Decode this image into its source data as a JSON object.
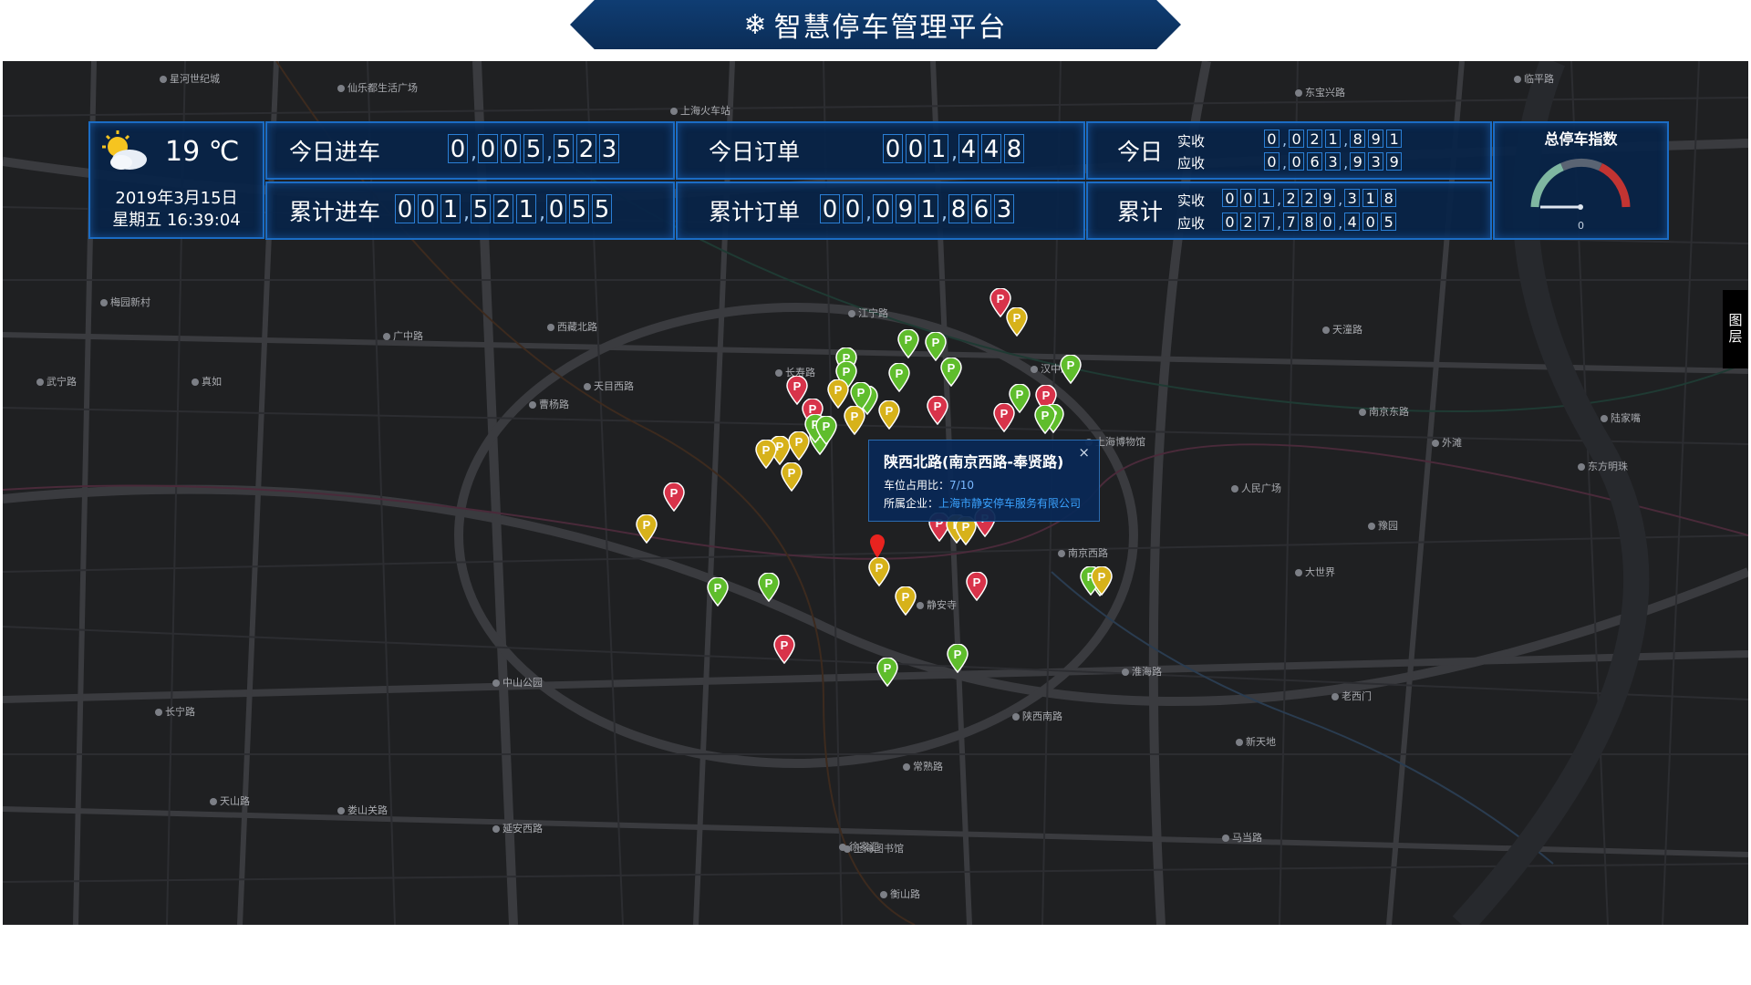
{
  "app_title": "智慧停车管理平台",
  "weather": {
    "temperature": "19 ℃",
    "date": "2019年3月15日",
    "weekday_time": "星期五  16:39:04",
    "icon": "partly-cloudy-icon"
  },
  "stats": {
    "today_in": {
      "label": "今日进车",
      "digits": [
        "0",
        ",",
        "0",
        "0",
        "5",
        ",",
        "5",
        "2",
        "3"
      ]
    },
    "total_in": {
      "label": "累计进车",
      "digits": [
        "0",
        "0",
        "1",
        ",",
        "5",
        "2",
        "1",
        ",",
        "0",
        "5",
        "5"
      ]
    },
    "today_orders": {
      "label": "今日订单",
      "digits": [
        "0",
        "0",
        "1",
        ",",
        "4",
        "4",
        "8"
      ]
    },
    "total_orders": {
      "label": "累计订单",
      "digits": [
        "0",
        "0",
        ",",
        "0",
        "9",
        "1",
        ",",
        "8",
        "6",
        "3"
      ]
    }
  },
  "money": {
    "today_label": "今日",
    "total_label": "累计",
    "paid_label": "实收",
    "due_label": "应收",
    "today_paid": [
      "0",
      ",",
      "0",
      "2",
      "1",
      ",",
      "8",
      "9",
      "1"
    ],
    "today_due": [
      "0",
      ",",
      "0",
      "6",
      "3",
      ",",
      "9",
      "3",
      "9"
    ],
    "total_paid": [
      "0",
      "0",
      "1",
      ",",
      "2",
      "2",
      "9",
      ",",
      "3",
      "1",
      "8"
    ],
    "total_due": [
      "0",
      "2",
      "7",
      ",",
      "7",
      "8",
      "0",
      ",",
      "4",
      "0",
      "5"
    ]
  },
  "gauge": {
    "title": "总停车指数",
    "value": "0",
    "value_fraction": 0
  },
  "popup": {
    "title": "陕西北路(南京西路-奉贤路)",
    "occupancy_label": "车位占用比：",
    "occupancy_value": "7/10",
    "company_label": "所属企业：",
    "company": "上海市静安停车服务有限公司",
    "close_icon": "close-icon"
  },
  "layer_tab": "图层",
  "colors": {
    "green": "#5fbd2c",
    "yellow": "#d7b21a",
    "red": "#d8334a",
    "panel_border": "#1b6cc4",
    "title_bg": "#0f3d73"
  },
  "map_labels": [
    "星河世纪城",
    "仙乐都生活广场",
    "上海火车站",
    "东宝兴路",
    "临平路",
    "梅园新村",
    "广中路",
    "西藏北路",
    "天目西路",
    "真如",
    "武宁路",
    "曹杨路",
    "长寿路",
    "江宁路",
    "南京西路",
    "人民广场",
    "南京东路",
    "陆家嘴",
    "东方明珠",
    "外滩",
    "豫园",
    "大世界",
    "新天地",
    "淮海路",
    "陕西南路",
    "常熟路",
    "徐家汇",
    "长宁路",
    "天山路",
    "中山公园",
    "娄山关路",
    "延安西路",
    "上海图书馆",
    "衡山路",
    "汉中路",
    "静安寺",
    "老西门",
    "马当路",
    "天潼路",
    "上海博物馆"
  ],
  "pins": [
    {
      "c": "red"
    },
    {
      "c": "yellow"
    },
    {
      "c": "green"
    },
    {
      "c": "green"
    },
    {
      "c": "green"
    },
    {
      "c": "green"
    },
    {
      "c": "green"
    },
    {
      "c": "green"
    },
    {
      "c": "green"
    },
    {
      "c": "yellow"
    },
    {
      "c": "green"
    },
    {
      "c": "red"
    },
    {
      "c": "red"
    },
    {
      "c": "yellow"
    },
    {
      "c": "yellow"
    },
    {
      "c": "red"
    },
    {
      "c": "red"
    },
    {
      "c": "green"
    },
    {
      "c": "green"
    },
    {
      "c": "red"
    },
    {
      "c": "green"
    },
    {
      "c": "green"
    },
    {
      "c": "yellow"
    },
    {
      "c": "yellow"
    },
    {
      "c": "yellow"
    },
    {
      "c": "yellow"
    },
    {
      "c": "green"
    },
    {
      "c": "green"
    },
    {
      "c": "green"
    },
    {
      "c": "red"
    },
    {
      "c": "yellow"
    },
    {
      "c": "red"
    },
    {
      "c": "red"
    },
    {
      "c": "yellow"
    },
    {
      "c": "yellow"
    },
    {
      "c": "green"
    },
    {
      "c": "green"
    },
    {
      "c": "yellow"
    },
    {
      "c": "red"
    },
    {
      "c": "red"
    },
    {
      "c": "green"
    },
    {
      "c": "green"
    },
    {
      "c": "yellow"
    },
    {
      "c": "green"
    },
    {
      "c": "green"
    },
    {
      "c": "yellow"
    }
  ]
}
